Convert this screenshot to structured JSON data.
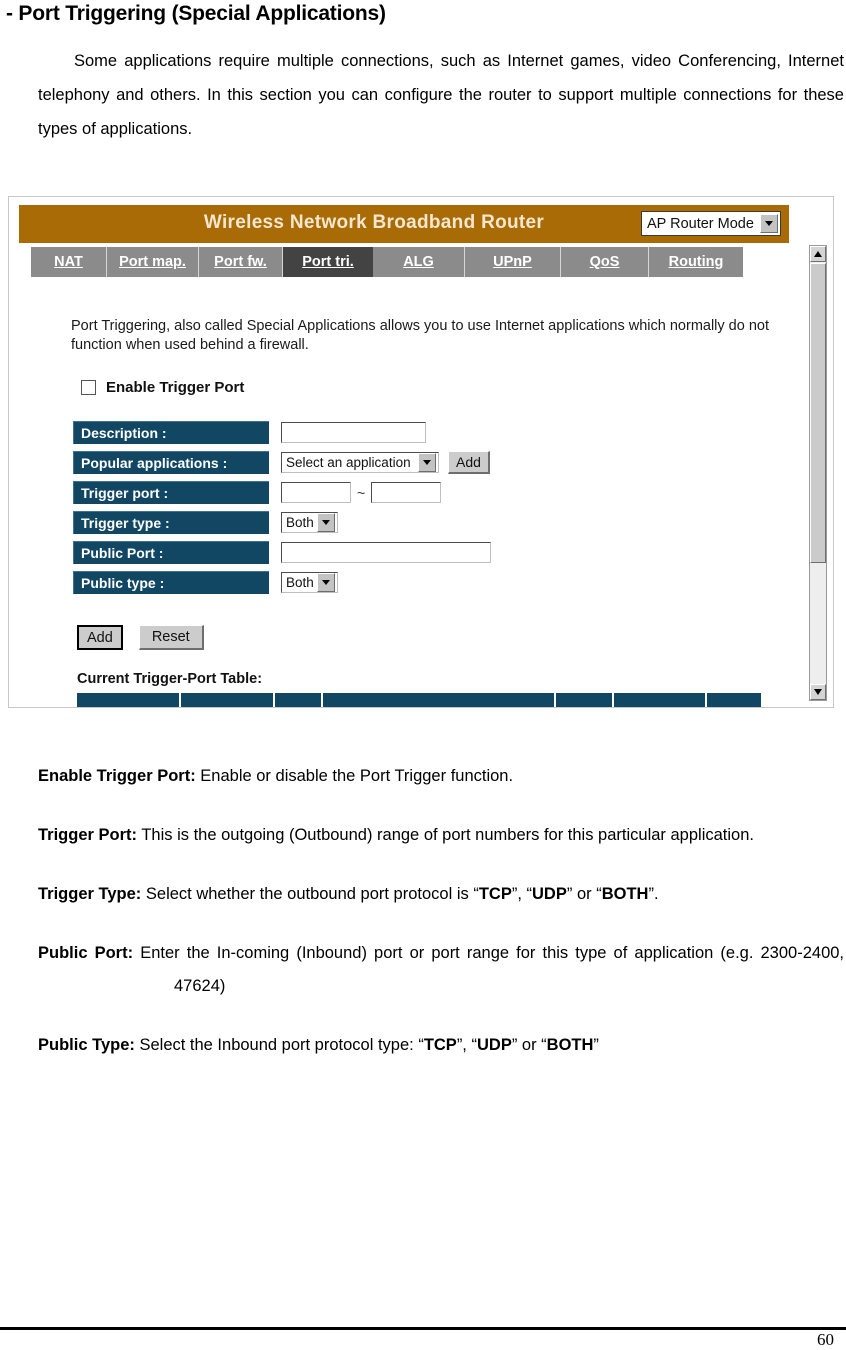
{
  "page": {
    "heading": "- Port Triggering (Special Applications)",
    "intro": "Some applications require multiple connections, such as Internet games, video Conferencing, Internet telephony and others. In this section you can configure the router to support multiple connections for these types of applications.",
    "page_number": "60"
  },
  "router_ui": {
    "banner": {
      "title": "Wireless Network Broadband Router",
      "mode_select_value": "AP Router Mode",
      "background_color": "#a96b05",
      "title_color": "#f5e7cf"
    },
    "tabs": [
      {
        "label": "NAT",
        "active": false
      },
      {
        "label": "Port map.",
        "active": false
      },
      {
        "label": "Port fw.",
        "active": false
      },
      {
        "label": "Port tri.",
        "active": true
      },
      {
        "label": "ALG",
        "active": false
      },
      {
        "label": "UPnP",
        "active": false
      },
      {
        "label": "QoS",
        "active": false
      },
      {
        "label": "Routing",
        "active": false
      }
    ],
    "tabbar_color": "#8b8b8b",
    "tab_active_color": "#434343",
    "description": "Port Triggering, also called Special Applications allows you to use Internet applications which normally do not function when used behind a firewall.",
    "enable_checkbox": {
      "label": "Enable Trigger Port",
      "checked": false
    },
    "form": {
      "label_color": "#124764",
      "rows": [
        {
          "label": "Description :",
          "control": "text",
          "value": ""
        },
        {
          "label": "Popular applications :",
          "control": "select",
          "value": "Select an application",
          "button": "Add"
        },
        {
          "label": "Trigger port :",
          "control": "range",
          "value_from": "",
          "separator": "~",
          "value_to": ""
        },
        {
          "label": "Trigger type :",
          "control": "select",
          "value": "Both"
        },
        {
          "label": "Public Port :",
          "control": "text",
          "value": ""
        },
        {
          "label": "Public type :",
          "control": "select",
          "value": "Both"
        }
      ]
    },
    "buttons": {
      "add": "Add",
      "reset": "Reset"
    },
    "trigger_table": {
      "caption": "Current Trigger-Port Table:"
    }
  },
  "definitions": [
    {
      "term": "Enable Trigger Port:",
      "text": "Enable or disable the Port Trigger function.",
      "hanging": false
    },
    {
      "term": "Trigger Port:",
      "text": "This is the outgoing (Outbound) range of port numbers for this particular application.",
      "hanging": true
    },
    {
      "term": "Trigger Type:",
      "text_before": "Select whether the outbound port protocol is “",
      "emphasis": [
        "TCP",
        "UDP",
        "BOTH"
      ],
      "text": "Select whether the outbound port protocol is “TCP”, “UDP” or “BOTH”.",
      "hanging": true
    },
    {
      "term": "Public Port:",
      "text": "Enter the In-coming (Inbound) port or port range for this type of application (e.g. 2300-2400, 47624)",
      "hanging": true
    },
    {
      "term": "Public Type:",
      "text": "Select the Inbound port protocol type: “TCP”, “UDP” or “BOTH”",
      "hanging": false
    }
  ]
}
